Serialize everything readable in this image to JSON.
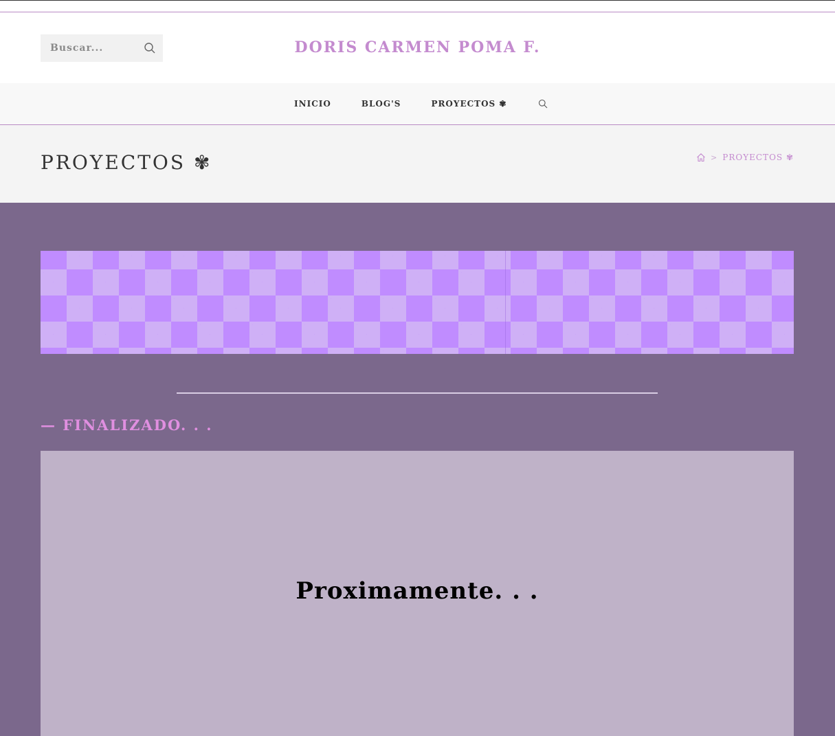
{
  "header": {
    "search_placeholder": "Buscar...",
    "site_title": "DORIS CARMEN POMA F."
  },
  "nav": {
    "items": [
      {
        "label": "INICIO"
      },
      {
        "label": "BLOG'S"
      },
      {
        "label": "PROYECTOS ✾"
      }
    ],
    "search_icon": "search-icon"
  },
  "page_header": {
    "title": "PROYECTOS ✾",
    "breadcrumb": {
      "home_icon": "home-icon",
      "separator": ">",
      "current": "PROYECTOS ✾"
    }
  },
  "main": {
    "section_heading": "— FINALIZADO. . .",
    "content_text": "Proximamente. . ."
  },
  "colors": {
    "accent": "#c48bcf",
    "main_background": "#7b688c",
    "content_box": "#bfb2c8",
    "checker_dark": "#c08cff",
    "checker_light": "#cfb0f6",
    "heading_pink": "#e08fe0"
  }
}
